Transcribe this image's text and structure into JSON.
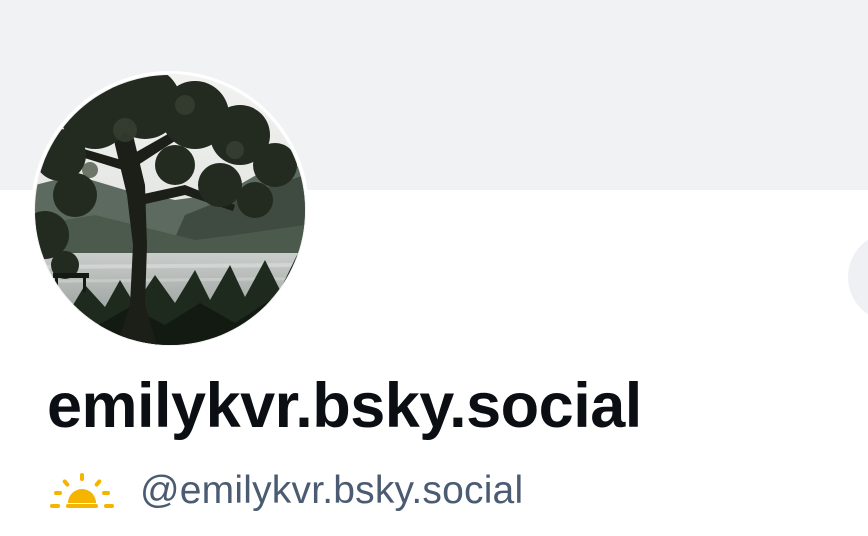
{
  "profile": {
    "display_name": "emilykvr.bsky.social",
    "handle": "@emilykvr.bsky.social",
    "handle_icon": "sun-icon",
    "avatar_icon": "avatar-tree-lake-photo"
  },
  "colors": {
    "banner": "#f1f2f4",
    "display_name": "#0b0f14",
    "handle": "#4b5c72",
    "sun": "#f5b400"
  }
}
